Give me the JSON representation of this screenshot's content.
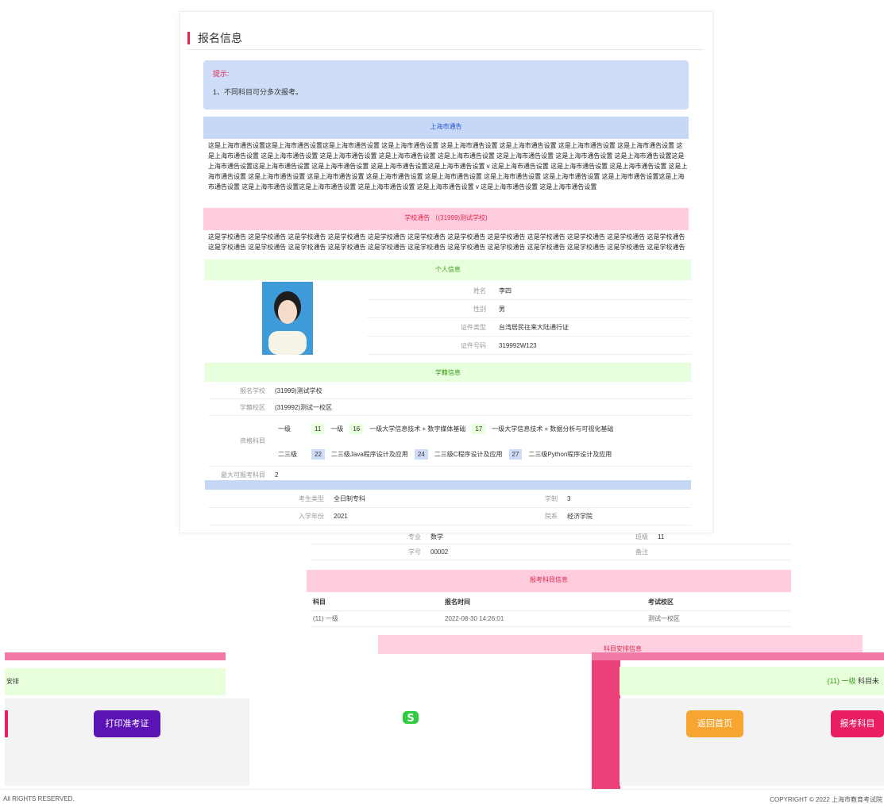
{
  "page_title": "报名信息",
  "tip": {
    "heading": "提示:",
    "line1": "1、不同科目可分多次报考。"
  },
  "city_notice": {
    "heading": "上海市通告",
    "body": "这是上海市通告设置这是上海市通告设置这是上海市通告设置 这是上海市通告设置 这是上海市通告设置 这是上海市通告设置 这是上海市通告设置 这是上海市通告设置 这是上海市通告设置 这是上海市通告设置 这是上海市通告设置 这是上海市通告设置 这是上海市通告设置 这是上海市通告设置 这是上海市通告设置 这是上海市通告设置这是上海市通告设置这是上海市通告设置 这是上海市通告设置 这是上海市通告设置这是上海市通告设置 v 这是上海市通告设置 这是上海市通告设置 这是上海市通告设置 这是上海市通告设置 这是上海市通告设置 这是上海市通告设置 这是上海市通告设置 这是上海市通告设置 这是上海市通告设置 这是上海市通告设置 这是上海市通告设置这是上海市通告设置 这是上海市通告设置这是上海市通告设置 这是上海市通告设置 这是上海市通告设置 v 这是上海市通告设置 这是上海市通告设置"
  },
  "school_notice": {
    "heading": "学校通告 （(31999)测试学校)",
    "body": "这是学校通告 这是学校通告 这是学校通告 这是学校通告 这是学校通告 这是学校通告 这是学校通告 这是学校通告 这是学校通告 这是学校通告 这是学校通告 这是学校通告 这是学校通告 这是学校通告 这是学校通告 这是学校通告 这是学校通告 这是学校通告 这是学校通告 这是学校通告 这是学校通告 这是学校通告 这是学校通告 这是学校通告"
  },
  "personal": {
    "heading": "个人信息",
    "name_label": "姓名",
    "name": "李四",
    "gender_label": "性别",
    "gender": "男",
    "idtype_label": "证件类型",
    "idtype": "台湾居民往来大陆通行证",
    "idno_label": "证件号码",
    "idno": "319992W123"
  },
  "school": {
    "heading": "学籍信息",
    "school_label": "报名学校",
    "school": "(31999)测试学校",
    "campus_label": "学籍校区",
    "campus": "(319992)测试一校区",
    "subjects_label": "资格科目",
    "level1": "一级",
    "level1_tags": [
      "11",
      "一级",
      "16",
      "一级大学信息技术 + 数字媒体基础",
      "17",
      "一级大学信息技术 + 数据分析与可视化基础"
    ],
    "level2": "二三级",
    "level2_tags": [
      "22",
      "二三级Java程序设计及应用",
      "24",
      "二三级C程序设计及应用",
      "27",
      "二三级Python程序设计及应用"
    ],
    "max_label": "最大可报考科目",
    "max": "2"
  },
  "student": {
    "type_label": "考生类型",
    "type": "全日制专科",
    "years_label": "学制",
    "years": "3",
    "year_label": "入学年份",
    "year": "2021",
    "dept_label": "院系",
    "dept": "经济学院",
    "major_label": "专业",
    "major": "数学",
    "class_label": "班级",
    "class": "11",
    "sno_label": "学号",
    "sno": "00002",
    "remark_label": "备注"
  },
  "exam": {
    "heading": "报考科目信息",
    "col1": "科目",
    "col2": "报名时间",
    "col3": "考试校区",
    "row_subject": "(11) 一级",
    "row_time": "2022-08-30 14:26:01",
    "row_campus": "测试一校区"
  },
  "fragment": {
    "arrange": "安排",
    "subject_row": "(11) 一级",
    "subject_suffix": "科目未",
    "subject_heading": "科目安排信息"
  },
  "buttons": {
    "print": "打印准考证",
    "home": "返回首页",
    "apply": "报考科目"
  },
  "footer": {
    "left": "All RIGHTS RESERVED.",
    "right": "COPYRIGHT © 2022 上海市教育考试院"
  },
  "colors": {
    "accent": "#e0264d",
    "print_btn": "#5b13b3",
    "home_btn": "#f6a630",
    "apply_btn": "#e91e63"
  }
}
